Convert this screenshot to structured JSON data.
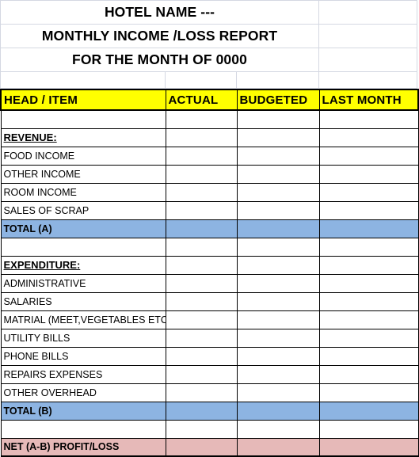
{
  "document": {
    "title_lines": [
      "HOTEL NAME ---",
      "MONTHLY INCOME /LOSS REPORT",
      "FOR THE MONTH OF 0000"
    ]
  },
  "colors": {
    "header_fill": "#FFFF00",
    "total_fill": "#8DB4E2",
    "net_fill": "#E6B9B8",
    "gridline": "#D4D8E2",
    "border": "#000000"
  },
  "table": {
    "columns": [
      "HEAD / ITEM",
      "ACTUAL",
      "BUDGETED",
      "LAST MONTH"
    ],
    "rows": [
      {
        "type": "blank",
        "label": "",
        "actual": "",
        "budgeted": "",
        "last_month": ""
      },
      {
        "type": "section",
        "label": "REVENUE:",
        "actual": "",
        "budgeted": "",
        "last_month": ""
      },
      {
        "type": "item",
        "label": "FOOD INCOME",
        "actual": "",
        "budgeted": "",
        "last_month": ""
      },
      {
        "type": "item",
        "label": "OTHER INCOME",
        "actual": "",
        "budgeted": "",
        "last_month": ""
      },
      {
        "type": "item",
        "label": "ROOM INCOME",
        "actual": "",
        "budgeted": "",
        "last_month": ""
      },
      {
        "type": "item",
        "label": "SALES OF SCRAP",
        "actual": "",
        "budgeted": "",
        "last_month": ""
      },
      {
        "type": "total",
        "label": "TOTAL (A)",
        "actual": "",
        "budgeted": "",
        "last_month": ""
      },
      {
        "type": "blank",
        "label": "",
        "actual": "",
        "budgeted": "",
        "last_month": ""
      },
      {
        "type": "section",
        "label": "EXPENDITURE:",
        "actual": "",
        "budgeted": "",
        "last_month": ""
      },
      {
        "type": "item",
        "label": "ADMINISTRATIVE",
        "actual": "",
        "budgeted": "",
        "last_month": ""
      },
      {
        "type": "item",
        "label": "SALARIES",
        "actual": "",
        "budgeted": "",
        "last_month": ""
      },
      {
        "type": "item",
        "label": "MATRIAL (MEET,VEGETABLES ETC)",
        "actual": "",
        "budgeted": "",
        "last_month": ""
      },
      {
        "type": "item",
        "label": "UTILITY BILLS",
        "actual": "",
        "budgeted": "",
        "last_month": ""
      },
      {
        "type": "item",
        "label": "PHONE BILLS",
        "actual": "",
        "budgeted": "",
        "last_month": ""
      },
      {
        "type": "item",
        "label": "REPAIRS EXPENSES",
        "actual": "",
        "budgeted": "",
        "last_month": ""
      },
      {
        "type": "item",
        "label": "OTHER OVERHEAD",
        "actual": "",
        "budgeted": "",
        "last_month": ""
      },
      {
        "type": "total",
        "label": "TOTAL (B)",
        "actual": "",
        "budgeted": "",
        "last_month": ""
      },
      {
        "type": "blank",
        "label": "",
        "actual": "",
        "budgeted": "",
        "last_month": ""
      },
      {
        "type": "net",
        "label": "NET (A-B) PROFIT/LOSS",
        "actual": "",
        "budgeted": "",
        "last_month": ""
      }
    ]
  }
}
